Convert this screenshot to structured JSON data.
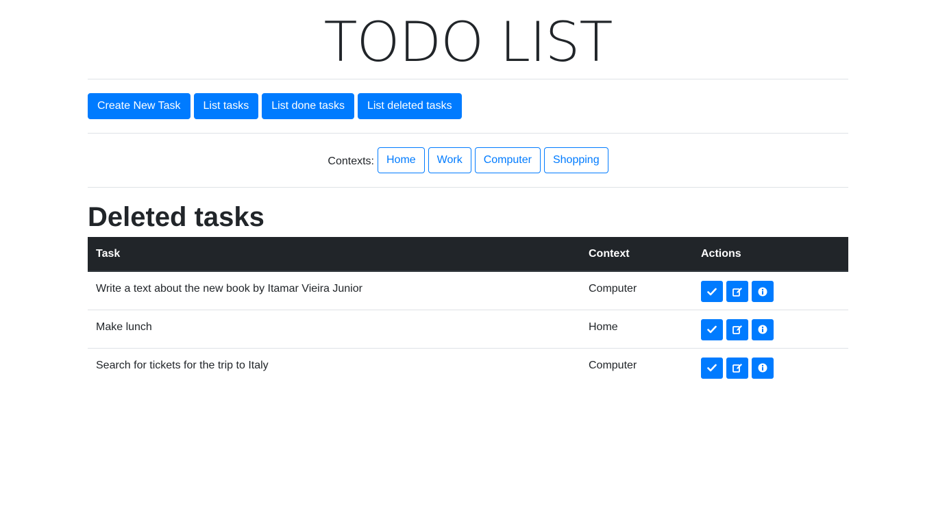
{
  "app": {
    "title": "TODO LIST"
  },
  "nav": {
    "buttons": [
      {
        "label": "Create New Task"
      },
      {
        "label": "List tasks"
      },
      {
        "label": "List done tasks"
      },
      {
        "label": "List deleted tasks"
      }
    ]
  },
  "contexts": {
    "label": "Contexts:",
    "items": [
      {
        "label": "Home"
      },
      {
        "label": "Work"
      },
      {
        "label": "Computer"
      },
      {
        "label": "Shopping"
      }
    ]
  },
  "section": {
    "title": "Deleted tasks"
  },
  "table": {
    "headers": {
      "task": "Task",
      "context": "Context",
      "actions": "Actions"
    },
    "rows": [
      {
        "task": "Write a text about the new book by Itamar Vieira Junior",
        "context": "Computer"
      },
      {
        "task": "Make lunch",
        "context": "Home"
      },
      {
        "task": "Search for tickets for the trip to Italy",
        "context": "Computer"
      }
    ],
    "action_icons": [
      "check-icon",
      "edit-icon",
      "info-icon"
    ]
  },
  "colors": {
    "primary": "#007bff",
    "dark": "#212529",
    "border": "#dee2e6"
  }
}
